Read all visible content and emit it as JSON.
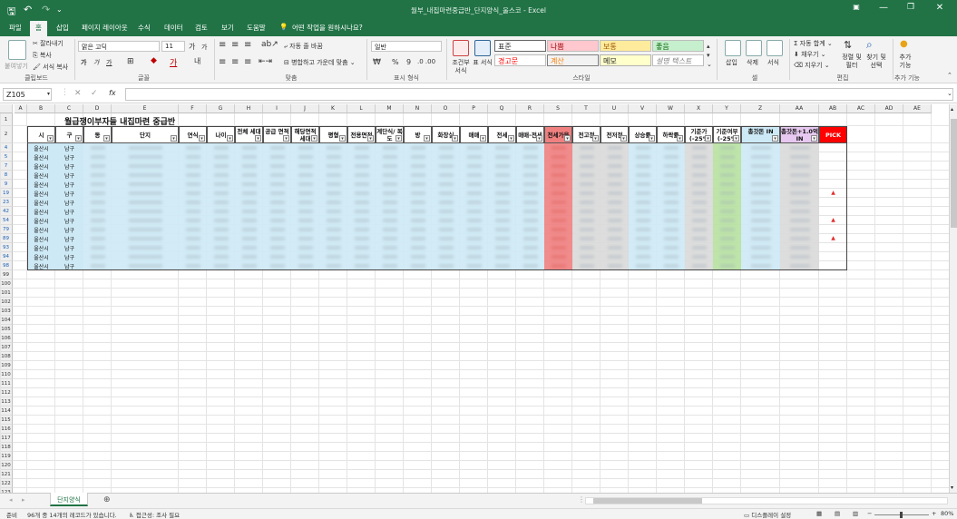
{
  "window": {
    "title": "월부_내집마련중급반_단지양식_울스코 - Excel"
  },
  "ribbon_tabs": [
    "파일",
    "홈",
    "삽입",
    "페이지 레이아웃",
    "수식",
    "데이터",
    "검토",
    "보기",
    "도움말"
  ],
  "tell_me": "어떤 작업을 원하시나요?",
  "clipboard": {
    "paste": "붙여넣기",
    "cut": "잘라내기",
    "copy": "복사",
    "format_painter": "서식 복사",
    "group": "클립보드"
  },
  "font": {
    "name": "맑은 고딕",
    "size": "11",
    "bold": "가",
    "italic": "가",
    "underline": "가",
    "grow": "가",
    "shrink": "가",
    "group": "글꼴"
  },
  "alignment": {
    "wrap": "자동 줄 바꿈",
    "merge": "병합하고 가운데 맞춤",
    "group": "맞춤"
  },
  "number": {
    "format": "일반",
    "percent": "%",
    "comma": "9",
    "group": "표시 형식"
  },
  "styles": {
    "conditional": "조건부 서식",
    "table": "표 서식",
    "cells": [
      "표준",
      "나쁨",
      "보통",
      "좋음",
      "경고문",
      "계산",
      "메모",
      "설명 텍스트"
    ],
    "group": "스타일"
  },
  "cells_group": {
    "insert": "삽입",
    "delete": "삭제",
    "format": "서식",
    "group": "셀"
  },
  "editing": {
    "autosum": "자동 합계",
    "fill": "채우기",
    "clear": "지우기",
    "sort": "정렬 및 필터",
    "find": "찾기 및 선택",
    "group": "편집"
  },
  "addins": {
    "label": "추가 기능",
    "group": "추가 기능"
  },
  "formula_bar": {
    "name_box": "Z105",
    "fx": "fx",
    "formula": ""
  },
  "columns": [
    "A",
    "B",
    "C",
    "D",
    "E",
    "F",
    "G",
    "H",
    "I",
    "J",
    "K",
    "L",
    "M",
    "N",
    "O",
    "P",
    "Q",
    "R",
    "S",
    "T",
    "U",
    "V",
    "W",
    "X",
    "Y",
    "Z",
    "AA",
    "AB",
    "AC",
    "AD",
    "AE"
  ],
  "sheet": {
    "title": "월급쟁이부자들 내집마련 중급반",
    "headers": [
      "시",
      "구",
      "동",
      "단지",
      "연식",
      "나이",
      "전체 세대",
      "공급 면적",
      "해당면적 세대",
      "평형",
      "전용면적",
      "계단식/ 복도",
      "방",
      "화장실",
      "매매",
      "전세",
      "매매-전세",
      "전세가율",
      "전고점",
      "전저점",
      "상승률",
      "하락률",
      "기준가 (-25%",
      "기준여부 (-25%",
      "총갓돈 IN",
      "총갓돈+1.0억 IN",
      "PICK"
    ],
    "row_numbers": [
      "1",
      "2",
      "4",
      "5",
      "7",
      "8",
      "9",
      "19",
      "23",
      "42",
      "54",
      "79",
      "89",
      "93",
      "94",
      "98",
      "99",
      "100",
      "101",
      "102",
      "103",
      "104",
      "105",
      "106",
      "107",
      "108",
      "109",
      "110",
      "111",
      "112",
      "113",
      "114",
      "115",
      "116",
      "117",
      "118",
      "119",
      "120",
      "121",
      "122",
      "123"
    ],
    "blue_rows": [
      "4",
      "5",
      "7",
      "8",
      "9",
      "19",
      "23",
      "42",
      "54",
      "79",
      "89",
      "93",
      "94",
      "98"
    ],
    "data_rows": [
      {
        "si": "울산시",
        "gu": "남구",
        "pick": ""
      },
      {
        "si": "울산시",
        "gu": "남구",
        "pick": ""
      },
      {
        "si": "울산시",
        "gu": "남구",
        "pick": ""
      },
      {
        "si": "울산시",
        "gu": "남구",
        "pick": ""
      },
      {
        "si": "울산시",
        "gu": "남구",
        "pick": ""
      },
      {
        "si": "울산시",
        "gu": "남구",
        "pick": "▲"
      },
      {
        "si": "울산시",
        "gu": "남구",
        "pick": ""
      },
      {
        "si": "울산시",
        "gu": "남구",
        "pick": ""
      },
      {
        "si": "울산시",
        "gu": "남구",
        "pick": "▲"
      },
      {
        "si": "울산시",
        "gu": "남구",
        "pick": ""
      },
      {
        "si": "울산시",
        "gu": "남구",
        "pick": "▲"
      },
      {
        "si": "울산시",
        "gu": "남구",
        "pick": ""
      },
      {
        "si": "울산시",
        "gu": "남구",
        "pick": ""
      },
      {
        "si": "울산시",
        "gu": "남구",
        "pick": ""
      }
    ]
  },
  "sheet_tabs": [
    "단지양식"
  ],
  "status": {
    "ready": "준비",
    "records": "96개 중 14개의 레코드가 있습니다.",
    "accessibility": "접근성: 조사 필요",
    "display": "디스플레이 설정",
    "zoom": "80%"
  },
  "colors": {
    "excel_green": "#217346",
    "light_blue": "#cde9f5",
    "pink": "#f08080",
    "gray": "#d9d9d9",
    "green": "#b7e1a1",
    "purple": "#e6c8f0",
    "pick_red": "#ff0000"
  }
}
